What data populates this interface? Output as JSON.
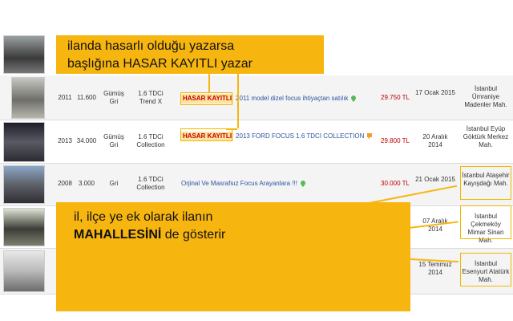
{
  "annotations": {
    "top_banner": {
      "line1": "ilanda hasarlı olduğu yazarsa",
      "line2": "başlığına HASAR KAYITLI yazar"
    },
    "bottom_banner": {
      "line1": "il, ilçe ye ek olarak ilanın",
      "line2_bold": "MAHALLESİNİ",
      "line2_rest": " de gösterir"
    }
  },
  "listings": [
    {
      "year": "2011",
      "km": "11.600",
      "color": "Gümüş Gri",
      "model": "1.6 TDCi Trend X",
      "badge": "HASAR KAYITLI",
      "title": "2011 model dizel focus ihtiyaçtan satılık",
      "price": "29.750 TL",
      "date": "17 Ocak 2015",
      "location": "İstanbul Ümraniye Madenler Mah."
    },
    {
      "year": "2013",
      "km": "34.000",
      "color": "Gümüş Gri",
      "model": "1.6 TDCi Collection",
      "badge": "HASAR KAYITLI",
      "title": "2013 FORD FOCUS 1.6 TDCI COLLECTION",
      "price": "29.800 TL",
      "date": "20 Aralık 2014",
      "location": "İstanbul Eyüp Göktürk Merkez Mah."
    },
    {
      "year": "2008",
      "km": "3.000",
      "color": "Gri",
      "model": "1.6 TDCi Collection",
      "badge": "",
      "title": "Orjinal Ve Masrafsız Focus Arayanlara !!!",
      "price": "30.000 TL",
      "date": "21 Ocak 2015",
      "location": "İstanbul Ataşehir Kayışdağı Mah."
    },
    {
      "year": "",
      "km": "",
      "color": "",
      "model": "",
      "badge": "",
      "title": "",
      "price": "",
      "date": "07 Aralık 2014",
      "location": "İstanbul Çekmeköy Mimar Sinan Mah."
    },
    {
      "year": "",
      "km": "",
      "color": "",
      "model": "",
      "badge": "",
      "title": "",
      "price": "",
      "date": "15 Temmuz 2014",
      "location": "İstanbul Esenyurt Atatürk Mah."
    }
  ],
  "colors": {
    "accent": "#f7b50f",
    "price": "#c00000",
    "link": "#2a55a0"
  }
}
